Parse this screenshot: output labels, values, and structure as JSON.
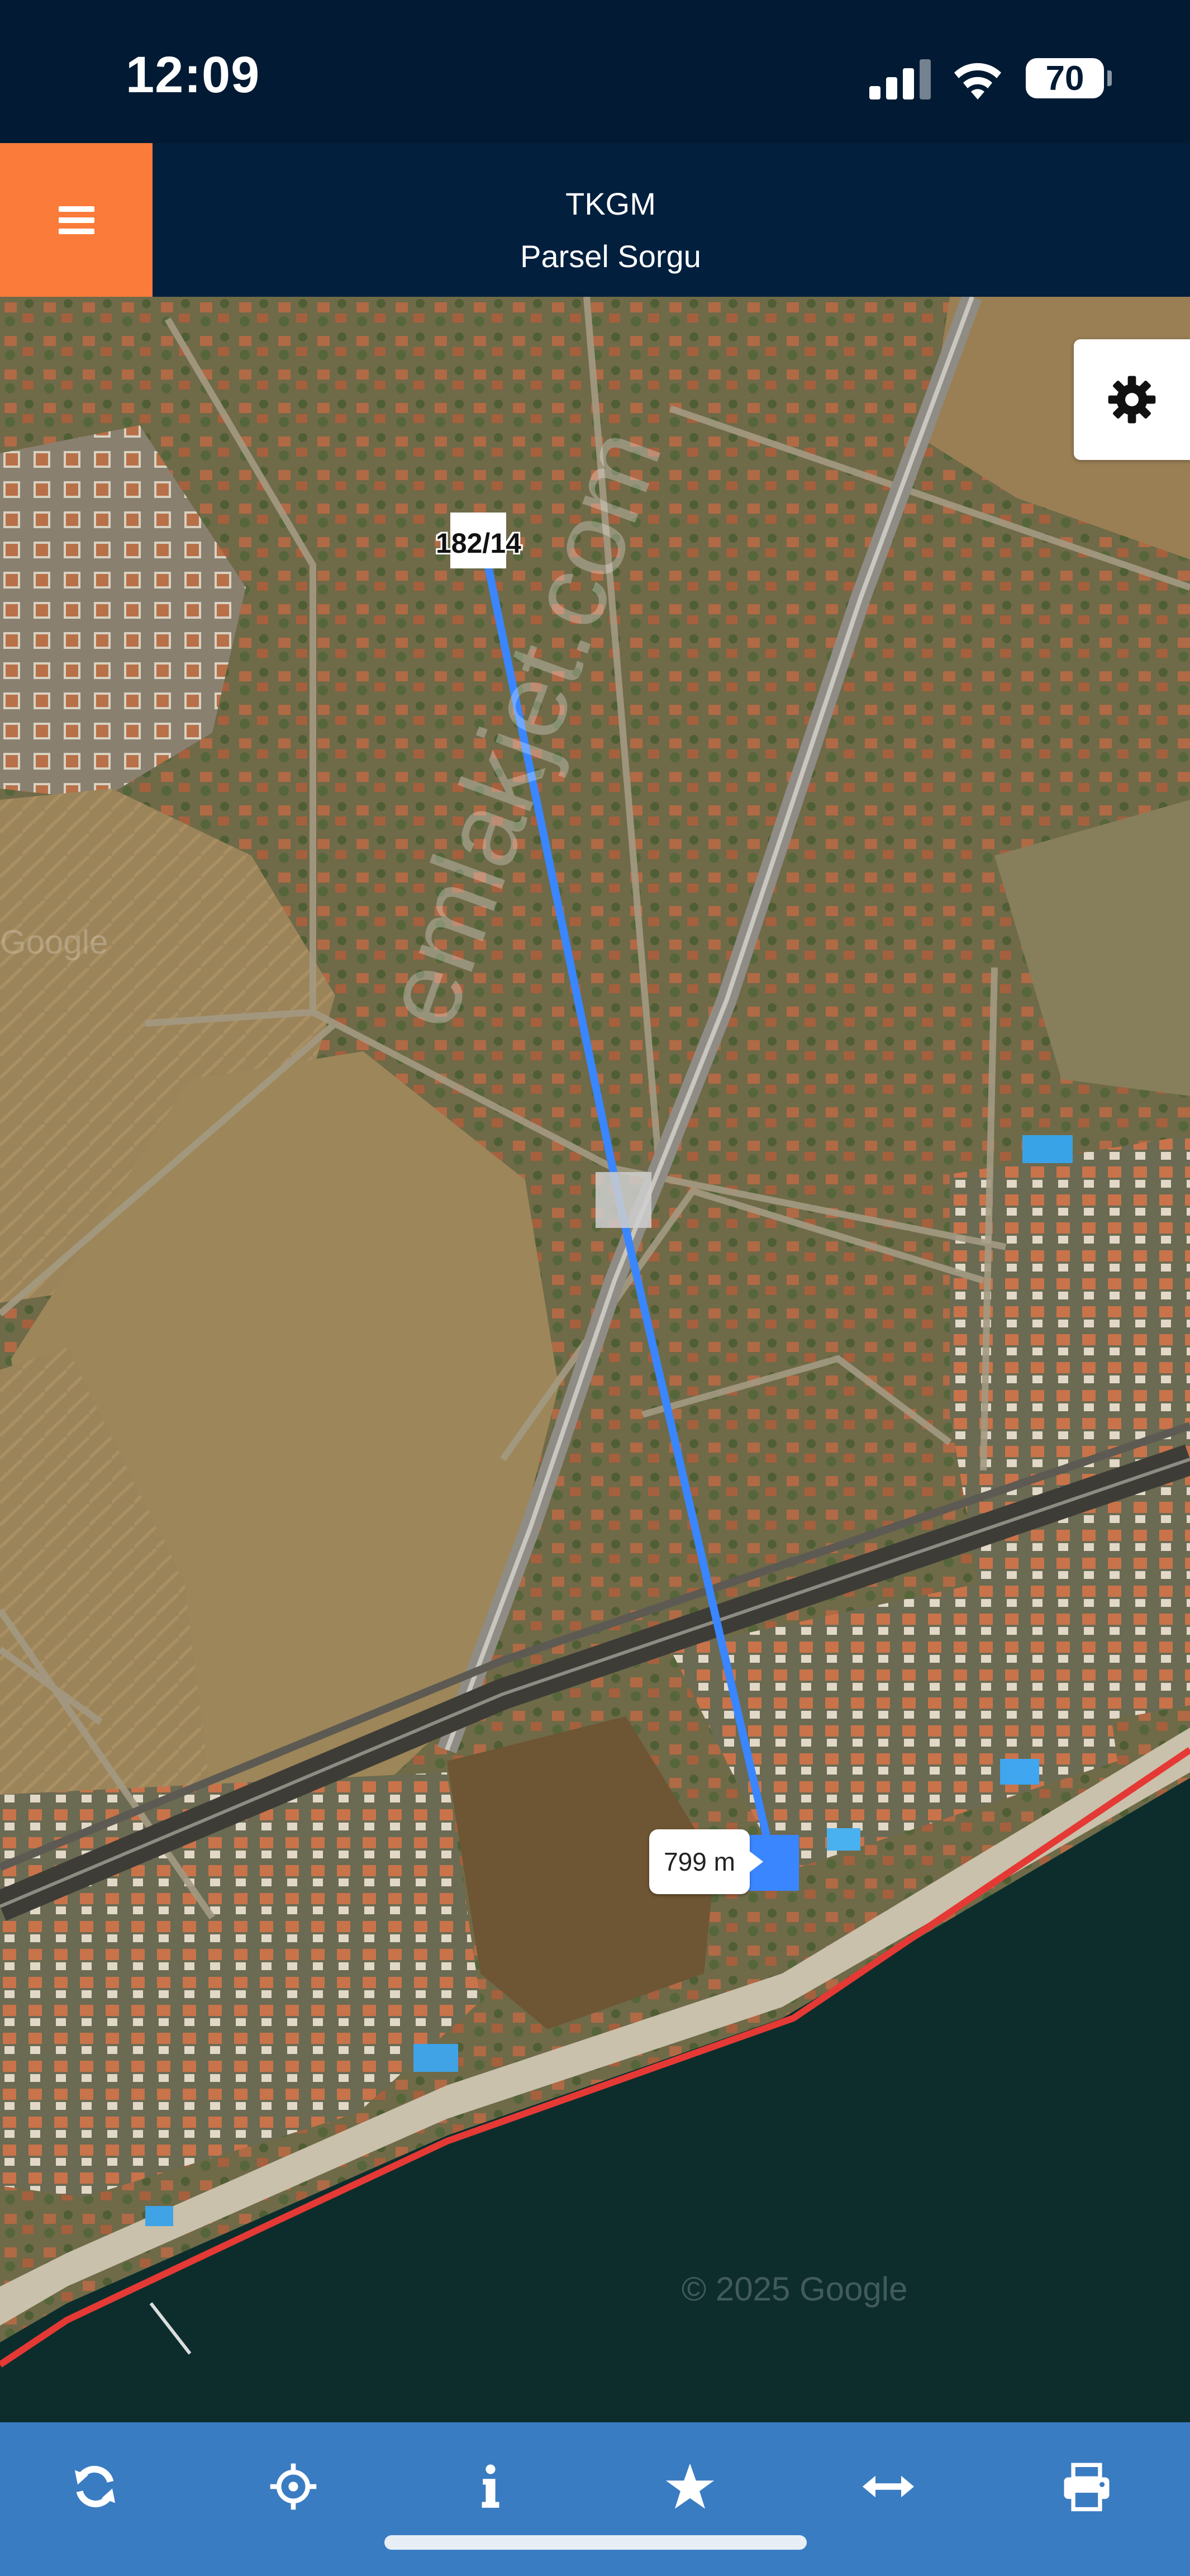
{
  "status_bar": {
    "time": "12:09",
    "battery": "70"
  },
  "header": {
    "title": "TKGM",
    "subtitle": "Parsel Sorgu",
    "menu_icon": "hamburger-icon"
  },
  "map": {
    "parcel_label": "182/14",
    "distance_label": "799 m",
    "watermark": "emlakjet.com",
    "attribution": "© 2025 Google",
    "attribution_faint": "Google",
    "settings_icon": "gear-icon",
    "colors": {
      "measure_line": "#3a86ff",
      "coast_line": "#e53935",
      "sea": "#0c2d2c"
    }
  },
  "toolbar": {
    "buttons": [
      {
        "icon": "refresh-icon"
      },
      {
        "icon": "locate-icon"
      },
      {
        "icon": "info-icon"
      },
      {
        "icon": "star-icon"
      },
      {
        "icon": "measure-icon"
      },
      {
        "icon": "print-icon"
      }
    ]
  }
}
